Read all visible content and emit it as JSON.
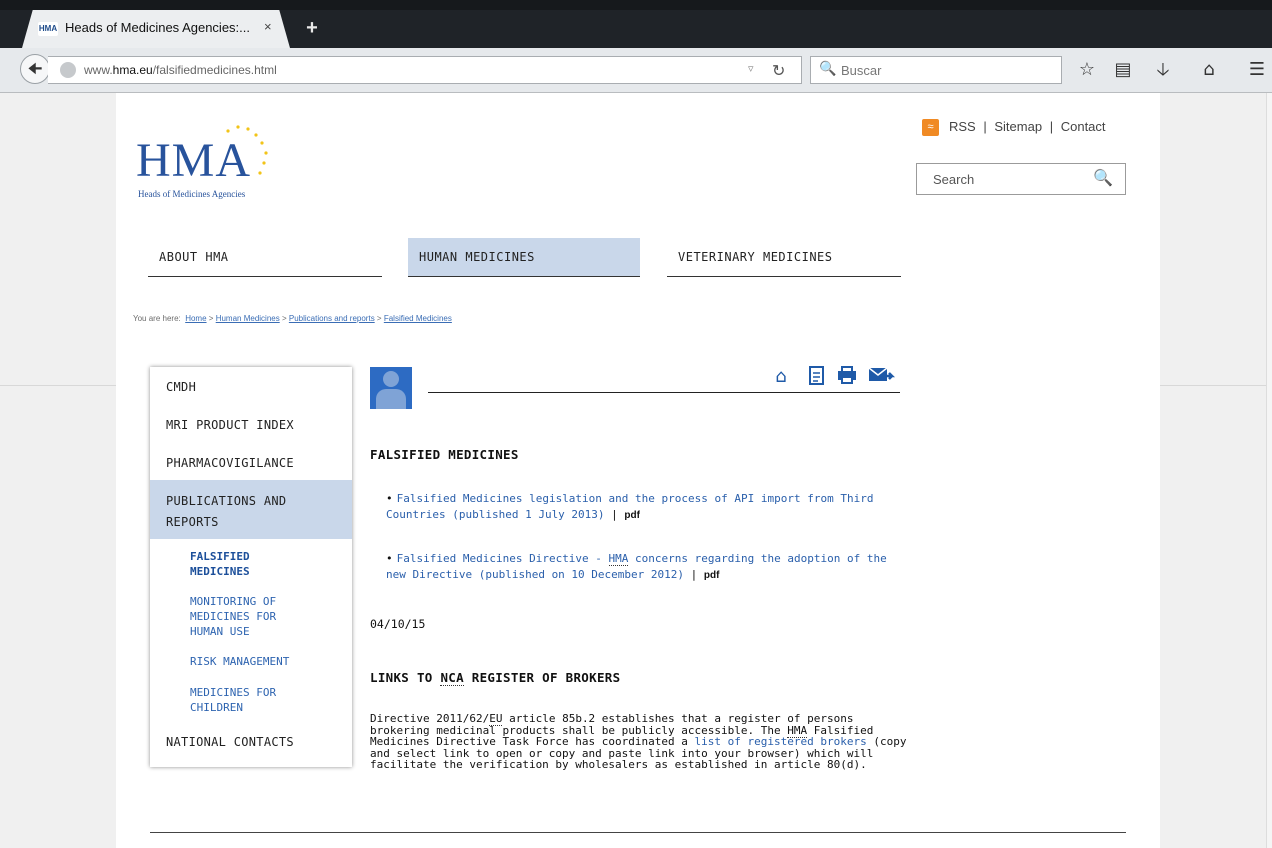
{
  "browser": {
    "tab_title": "Heads of Medicines Agencies:...",
    "tab_close": "×",
    "favicon_text": "HMA",
    "new_tab": "+",
    "url_prefix": "www.",
    "url_domain": "hma.eu",
    "url_path": "/falsifiedmedicines.html",
    "search_placeholder": "Buscar"
  },
  "site": {
    "logo_text": "HMA",
    "logo_subtitle": "Heads of Medicines Agencies",
    "top_links": {
      "rss": "RSS",
      "sitemap": "Sitemap",
      "contact": "Contact",
      "separator": "|"
    },
    "search_placeholder": "Search",
    "main_nav": [
      {
        "label": "ABOUT HMA",
        "active": false
      },
      {
        "label": "HUMAN MEDICINES",
        "active": true
      },
      {
        "label": "VETERINARY MEDICINES",
        "active": false
      }
    ],
    "breadcrumb": {
      "prefix": "You are here:",
      "items": [
        "Home",
        "Human Medicines",
        "Publications and reports",
        "Falsified Medicines"
      ],
      "separator": ">"
    }
  },
  "sidebar": {
    "items": [
      {
        "label": "CMDH"
      },
      {
        "label": "MRI PRODUCT INDEX"
      },
      {
        "label": "PHARMACOVIGILANCE"
      },
      {
        "label_line1": "PUBLICATIONS AND",
        "label_line2": "REPORTS",
        "active": true
      },
      {
        "label": "NATIONAL CONTACTS"
      }
    ],
    "subitems": [
      {
        "line1": "FALSIFIED",
        "line2": "MEDICINES",
        "current": true
      },
      {
        "line1": "MONITORING OF",
        "line2": "MEDICINES FOR",
        "line3": "HUMAN USE"
      },
      {
        "line1": "RISK MANAGEMENT"
      },
      {
        "line1": "MEDICINES FOR",
        "line2": "CHILDREN"
      }
    ]
  },
  "content": {
    "heading": "FALSIFIED MEDICINES",
    "documents": [
      {
        "text": "Falsified Medicines legislation and the process of API import from Third Countries (published 1 July 2013)",
        "format": "pdf"
      },
      {
        "text_before": "Falsified Medicines Directive - ",
        "abbr": "HMA",
        "text_after": " concerns regarding the adoption of the new Directive (published on 10 December 2012)",
        "format": "pdf"
      }
    ],
    "date": "04/10/15",
    "section2": {
      "heading_before": "LINKS TO ",
      "heading_abbr": "NCA",
      "heading_after": " REGISTER OF BROKERS",
      "p1": "Directive 2011/62/",
      "p1_abbr": "EU",
      "p2": " article 85b.2 establishes that a register of persons brokering medicinal products shall be publicly accessible. The ",
      "p2_abbr": "HMA",
      "p3": " Falsified Medicines Directive Task Force has coordinated a ",
      "link": "list of registered brokers",
      "p4": " (copy and select link to open or copy and paste link into your browser) which will facilitate the verification by wholesalers as established in article 80(d)."
    }
  },
  "colors": {
    "nav_active": "#c9d7ea",
    "link": "#2a5fab",
    "logo": "#28539c",
    "rss": "#f08a24"
  }
}
